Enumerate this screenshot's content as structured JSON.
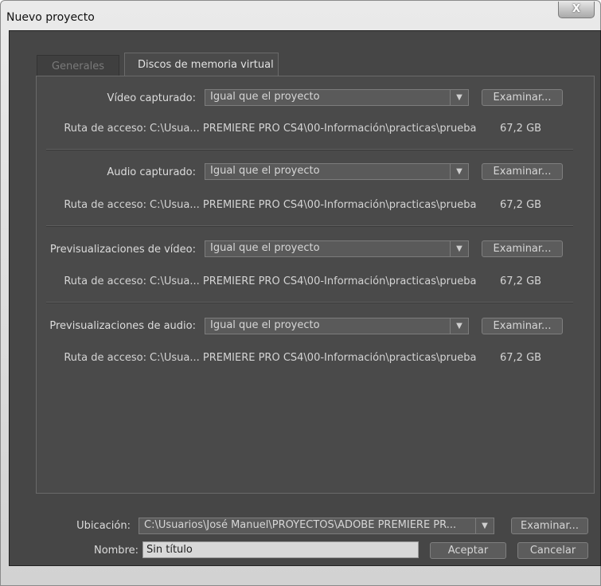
{
  "window": {
    "title": "Nuevo proyecto",
    "close_glyph": "X"
  },
  "tabs": [
    {
      "label": "Generales",
      "active": false
    },
    {
      "label": "Discos de memoria virtual",
      "active": true
    }
  ],
  "scratch": {
    "path_label": "Ruta de acceso:",
    "browse_label": "Examinar...",
    "items": [
      {
        "label": "Vídeo capturado:",
        "value": "Igual que el proyecto",
        "path": "C:\\Usua... PREMIERE PRO CS4\\00-Información\\practicas\\prueba",
        "size": "67,2 GB"
      },
      {
        "label": "Audio capturado:",
        "value": "Igual que el proyecto",
        "path": "C:\\Usua... PREMIERE PRO CS4\\00-Información\\practicas\\prueba",
        "size": "67,2 GB"
      },
      {
        "label": "Previsualizaciones de vídeo:",
        "value": "Igual que el proyecto",
        "path": "C:\\Usua... PREMIERE PRO CS4\\00-Información\\practicas\\prueba",
        "size": "67,2 GB"
      },
      {
        "label": "Previsualizaciones de audio:",
        "value": "Igual que el proyecto",
        "path": "C:\\Usua... PREMIERE PRO CS4\\00-Información\\practicas\\prueba",
        "size": "67,2 GB"
      }
    ]
  },
  "footer": {
    "location_label": "Ubicación:",
    "location_value": "C:\\Usuarios\\José Manuel\\PROYECTOS\\ADOBE PREMIERE PR...",
    "browse_label": "Examinar...",
    "name_label": "Nombre:",
    "name_value": "Sin título",
    "ok_label": "Aceptar",
    "cancel_label": "Cancelar"
  },
  "icons": {
    "dropdown": "chevron-down-icon",
    "close": "close-icon"
  }
}
